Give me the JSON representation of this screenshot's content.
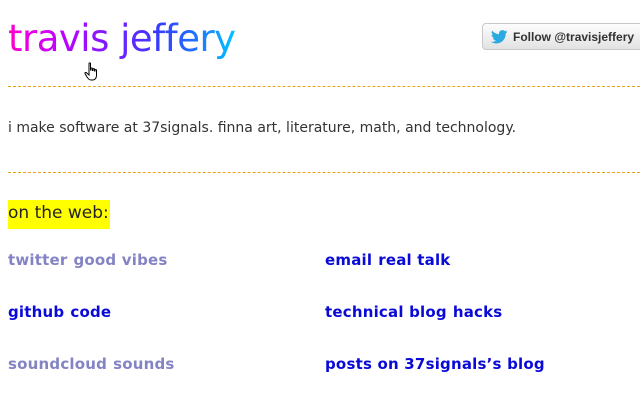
{
  "header": {
    "site_title": "travis jeffery",
    "follow_button_label": "Follow @travisjeffery"
  },
  "intro": {
    "tagline": "i make software at 37signals. finna art, literature, math, and technology."
  },
  "web_section": {
    "heading": "on the web:",
    "links": [
      {
        "service": "twitter",
        "description": "good vibes",
        "visited": true
      },
      {
        "service": "email",
        "description": "real talk",
        "visited": false
      },
      {
        "service": "github",
        "description": "code",
        "visited": false
      },
      {
        "service": "technical blog",
        "description": "hacks",
        "visited": false
      },
      {
        "service": "soundcloud",
        "description": "sounds",
        "visited": true
      },
      {
        "service": "posts on 37signals’s blog",
        "description": "",
        "visited": false
      }
    ]
  },
  "colors": {
    "title_gradient_start": "#ff00cc",
    "title_gradient_end": "#00c8ff",
    "visited_link": "#8484c4",
    "unvisited_link": "#0a0ad6",
    "divider": "#e8a317",
    "heading_highlight": "#ffff00"
  },
  "icons": {
    "follow_button": "twitter-bird-icon",
    "pointer": "hand-cursor-icon"
  }
}
